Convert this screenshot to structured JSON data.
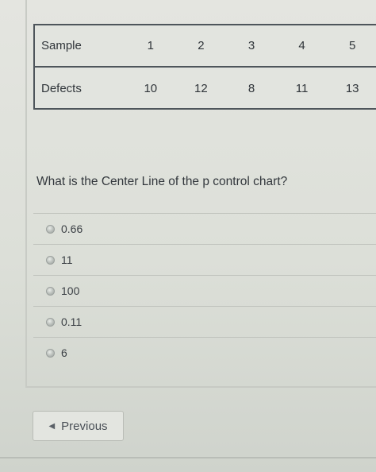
{
  "table": {
    "header": {
      "label": "Sample",
      "cells": [
        "1",
        "2",
        "3",
        "4",
        "5"
      ]
    },
    "row": {
      "label": "Defects",
      "cells": [
        "10",
        "12",
        "8",
        "11",
        "13"
      ]
    }
  },
  "question": {
    "text": "What is the Center Line of the p control chart?"
  },
  "options": [
    {
      "label": "0.66"
    },
    {
      "label": "11"
    },
    {
      "label": "100"
    },
    {
      "label": "0.11"
    },
    {
      "label": "6"
    }
  ],
  "navigation": {
    "previous_label": "Previous",
    "previous_icon": "chevron-left-icon"
  }
}
